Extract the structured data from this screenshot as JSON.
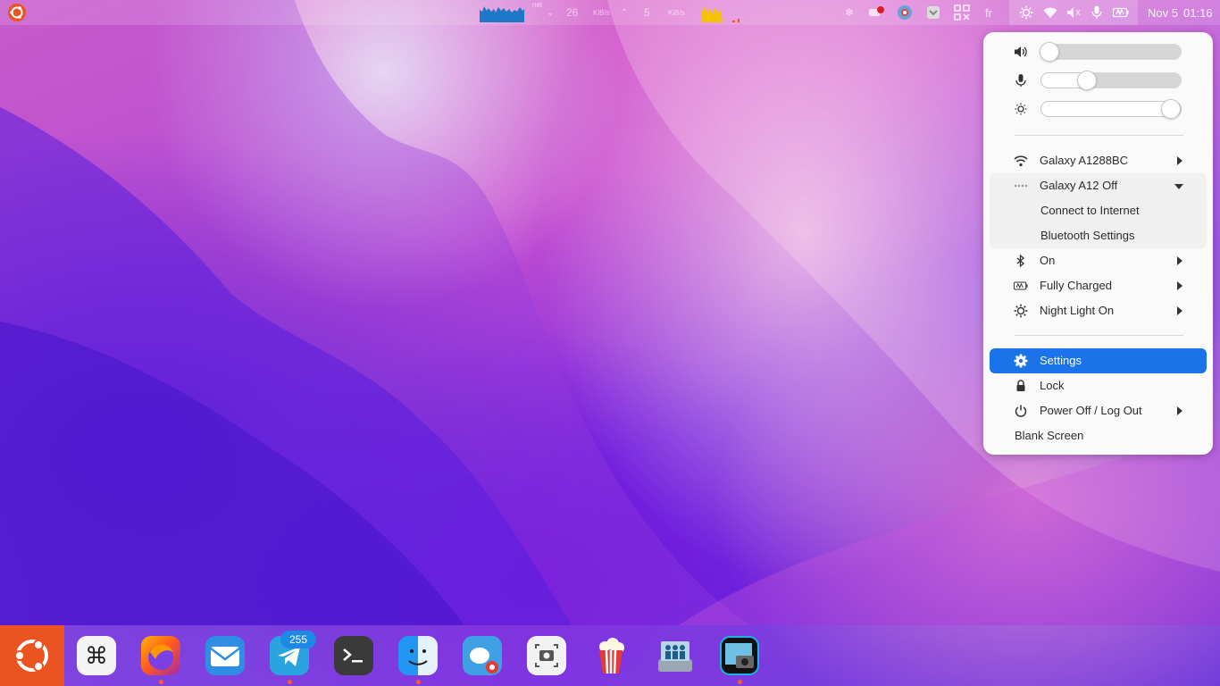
{
  "top_bar": {
    "net_label": "net",
    "net_down_value": "26",
    "net_down_unit": "KiB/s",
    "net_up_value": "5",
    "net_up_unit": "KiB/s",
    "keyboard_layout": "fr",
    "date": "Nov 5",
    "time": "01:16"
  },
  "system_menu": {
    "sliders": [
      {
        "name": "volume",
        "icon": "speaker-icon",
        "level": 0.05
      },
      {
        "name": "microphone",
        "icon": "microphone-icon",
        "level": 0.33
      },
      {
        "name": "brightness",
        "icon": "brightness-icon",
        "level": 0.95
      }
    ],
    "wifi_label": "Galaxy A1288BC",
    "hotspot_label": "Galaxy A12 Off",
    "hotspot_sub_connect": "Connect to Internet",
    "hotspot_sub_bt_settings": "Bluetooth Settings",
    "bluetooth_label": "On",
    "battery_label": "Fully Charged",
    "night_light_label": "Night Light On",
    "settings_label": "Settings",
    "lock_label": "Lock",
    "power_label": "Power Off / Log Out",
    "blank_screen_label": "Blank Screen"
  },
  "dock": {
    "telegram_badge": "255",
    "apps": [
      "ubuntu-launcher",
      "keyboard-shortcuts",
      "firefox",
      "mail",
      "telegram",
      "terminal",
      "finder",
      "gimp",
      "screenshot",
      "popcorn-time",
      "network-storage",
      "screenshot-tool"
    ]
  },
  "colors": {
    "accent": "#1a73e8",
    "ubuntu_orange": "#e95420"
  }
}
